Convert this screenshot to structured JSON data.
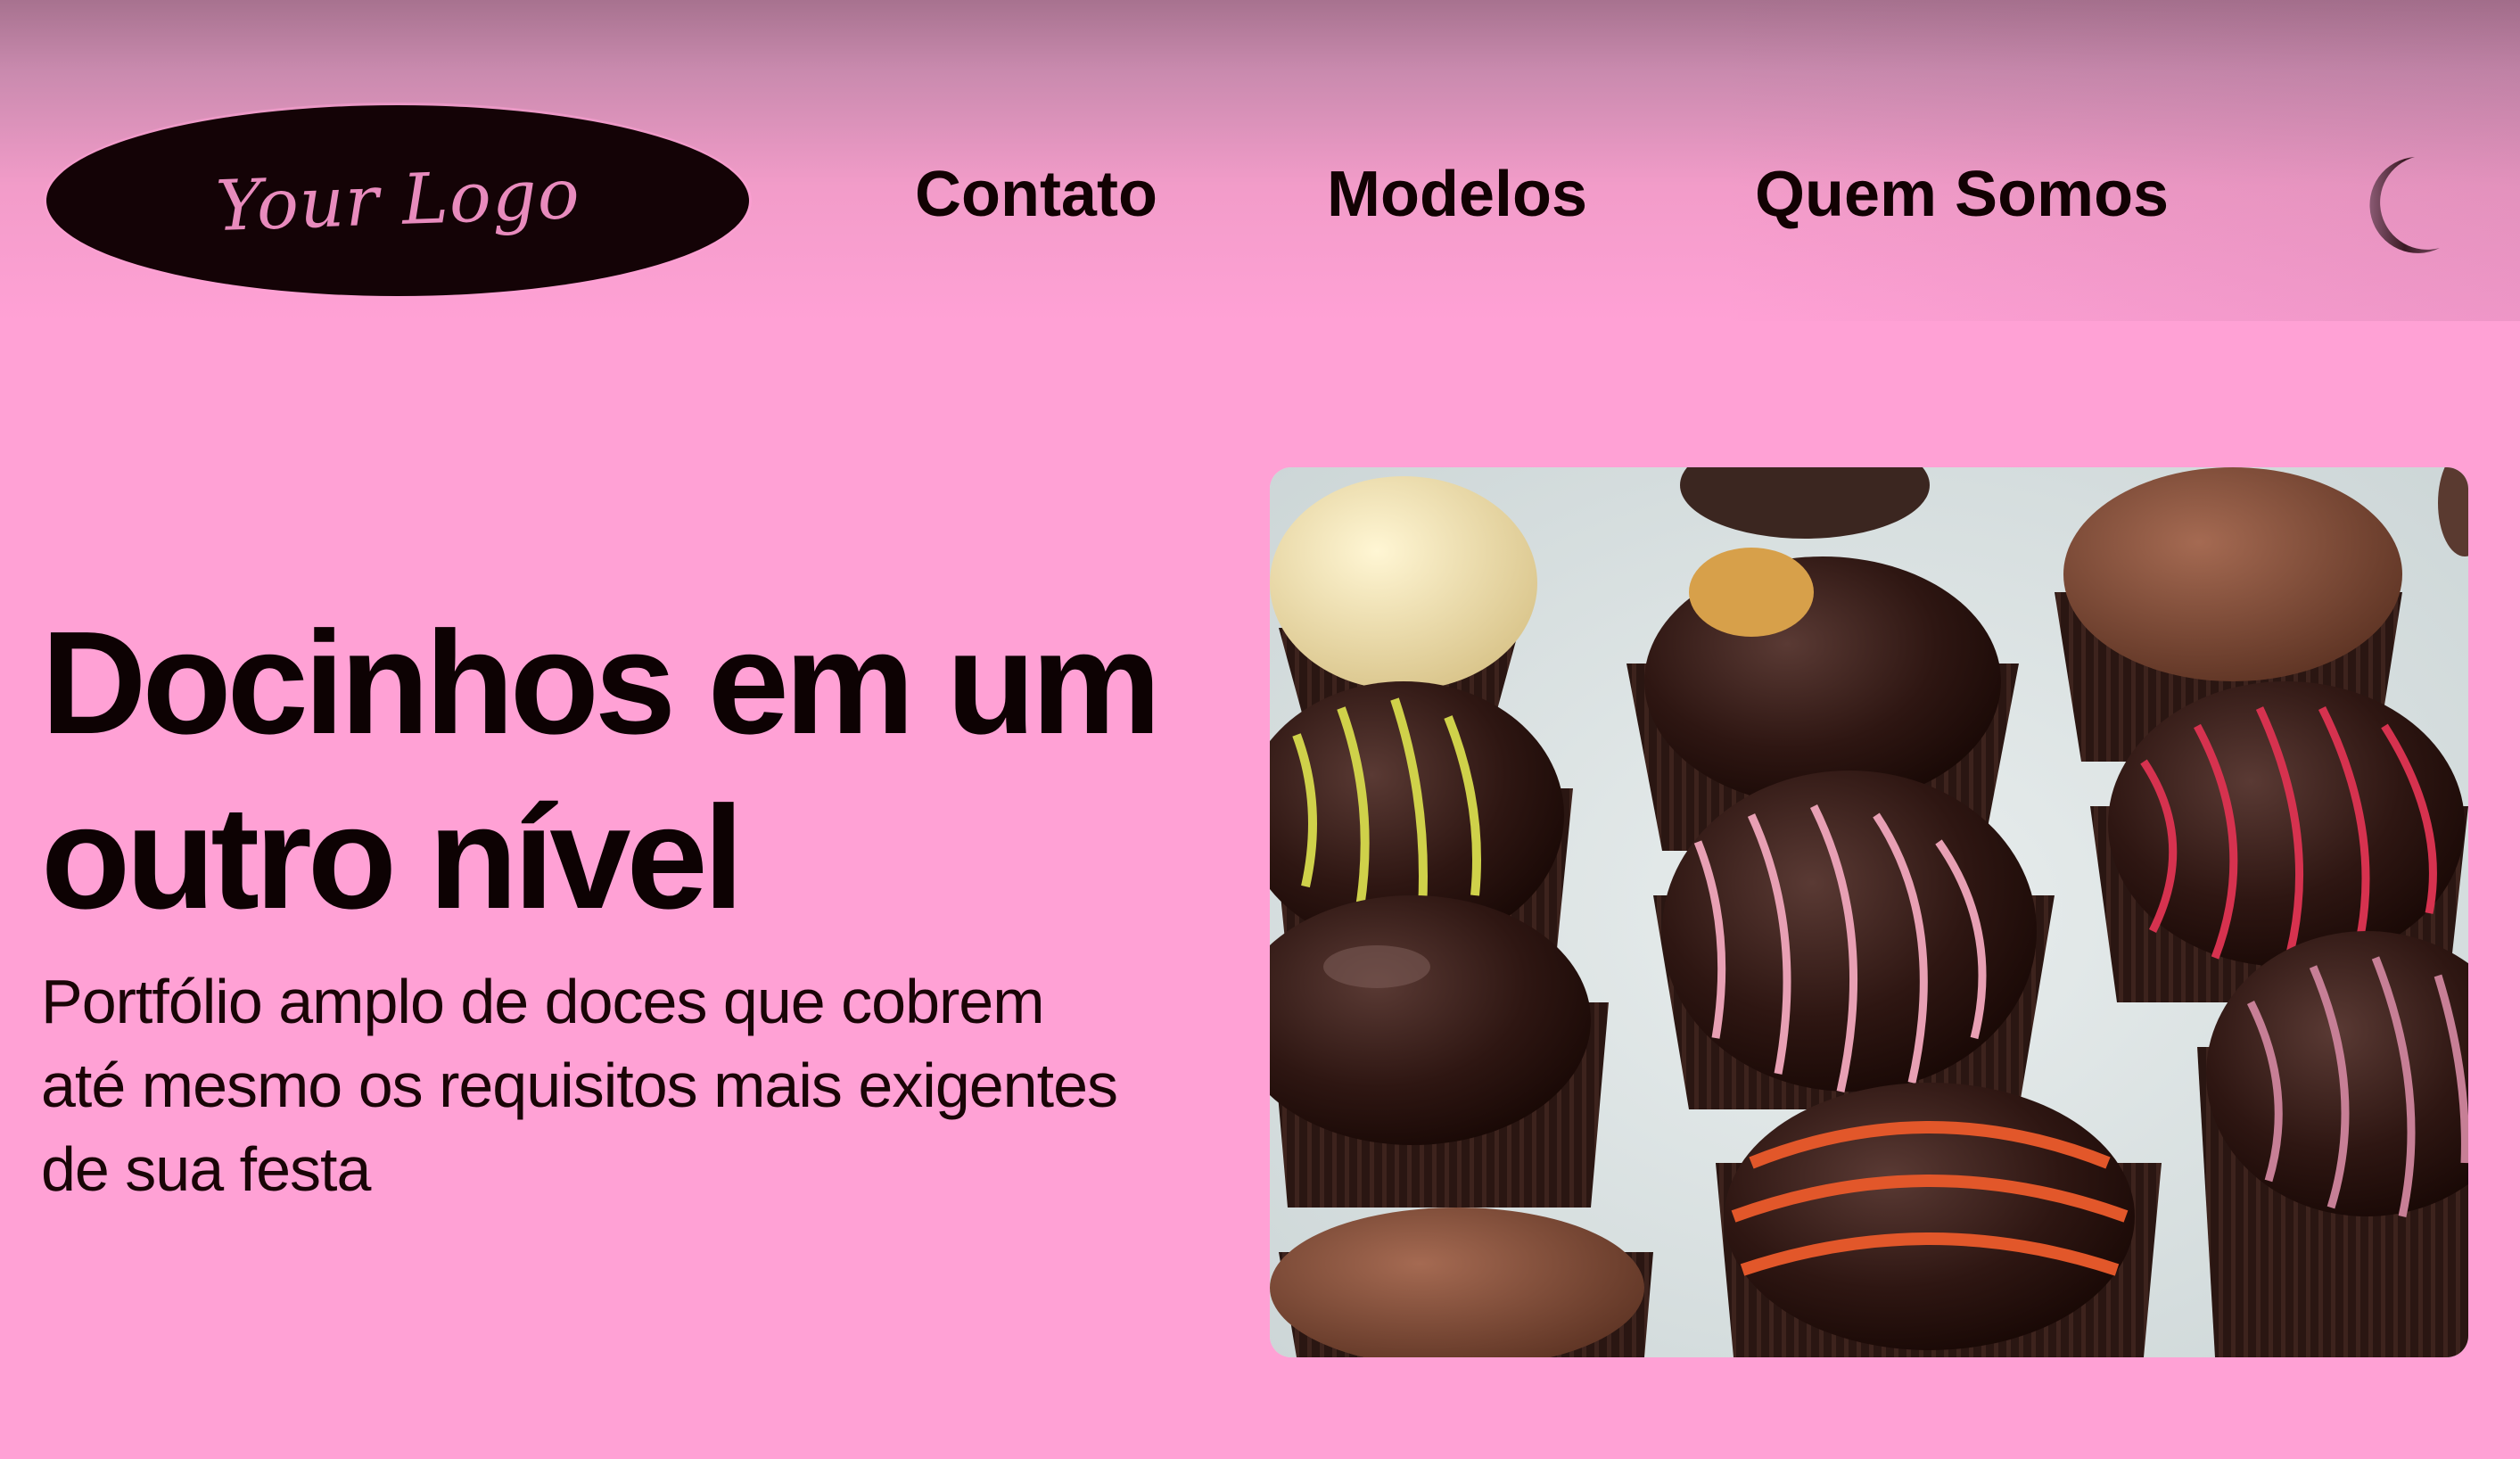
{
  "header": {
    "logo_text": "Your Logo",
    "nav": [
      {
        "label": "Contato"
      },
      {
        "label": "Modelos"
      },
      {
        "label": "Quem Somos"
      }
    ],
    "theme_icon": "moon-icon"
  },
  "hero": {
    "title_line1": "Docinhos em um",
    "title_line2": "outro nível",
    "subtitle_line1": "Portfólio amplo de doces que cobrem",
    "subtitle_line2": "até mesmo os requisitos mais exigentes",
    "subtitle_line3": "de sua festa"
  },
  "colors": {
    "background": "#ffa1d5",
    "text": "#0d0203",
    "logo_bg": "#140306",
    "logo_text": "#e88bbd"
  }
}
